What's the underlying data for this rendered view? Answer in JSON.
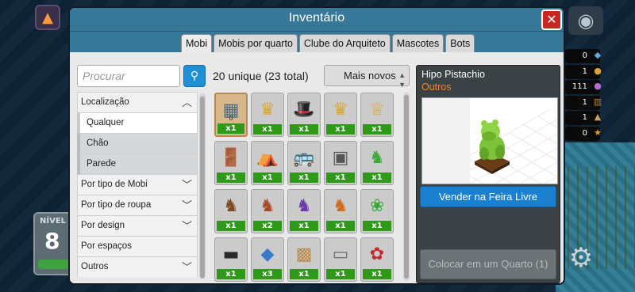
{
  "window": {
    "title": "Inventário",
    "close_label": "✕"
  },
  "tabs": [
    {
      "label": "Mobi",
      "active": true
    },
    {
      "label": "Mobis por quarto",
      "active": false
    },
    {
      "label": "Clube do Arquiteto",
      "active": false
    },
    {
      "label": "Mascotes",
      "active": false
    },
    {
      "label": "Bots",
      "active": false
    }
  ],
  "search": {
    "placeholder": "Procurar",
    "icon": "magnifier-icon"
  },
  "filters": {
    "location": {
      "label": "Localização",
      "expanded": true,
      "options": [
        "Qualquer",
        "Chão",
        "Parede"
      ],
      "selected": "Qualquer"
    },
    "groups": [
      {
        "label": "Por tipo de Mobi"
      },
      {
        "label": "Por tipo de roupa"
      },
      {
        "label": "Por design"
      },
      {
        "label": "Por espaços"
      },
      {
        "label": "Outros"
      }
    ]
  },
  "summary": {
    "count_text": "20 unique (23 total)"
  },
  "sort": {
    "selected": "Mais novos"
  },
  "items": [
    {
      "icon": "window-frame-icon",
      "glyph": "▦",
      "qty": "x1",
      "selected": true,
      "sub": "0"
    },
    {
      "icon": "gold-crown-icon",
      "glyph": "♛",
      "qty": "x1"
    },
    {
      "icon": "green-hat-icon",
      "glyph": "🎩",
      "qty": "x1"
    },
    {
      "icon": "gold-crown-icon",
      "glyph": "♛",
      "qty": "x1"
    },
    {
      "icon": "gold-cake-icon",
      "glyph": "♕",
      "qty": "x1"
    },
    {
      "icon": "door-icon",
      "glyph": "🚪",
      "qty": "x1"
    },
    {
      "icon": "table-icon",
      "glyph": "⛺",
      "qty": "x1"
    },
    {
      "icon": "van-icon",
      "glyph": "🚌",
      "qty": "x1"
    },
    {
      "icon": "safe-icon",
      "glyph": "▣",
      "qty": "x1"
    },
    {
      "icon": "green-hippo-statue-icon",
      "glyph": "♞",
      "qty": "x1"
    },
    {
      "icon": "brown-statue-icon",
      "glyph": "♞",
      "qty": "x1"
    },
    {
      "icon": "red-statue-icon",
      "glyph": "♞",
      "qty": "x2"
    },
    {
      "icon": "purple-statue-icon",
      "glyph": "♞",
      "qty": "x1"
    },
    {
      "icon": "orange-statue-icon",
      "glyph": "♞",
      "qty": "x1"
    },
    {
      "icon": "green-plant-icon",
      "glyph": "❀",
      "qty": "x1"
    },
    {
      "icon": "black-bench-icon",
      "glyph": "▬",
      "qty": "x1"
    },
    {
      "icon": "blue-mat-icon",
      "glyph": "◆",
      "qty": "x3"
    },
    {
      "icon": "wooden-crate-icon",
      "glyph": "▩",
      "qty": "x1"
    },
    {
      "icon": "gray-table-icon",
      "glyph": "▭",
      "qty": "x1"
    },
    {
      "icon": "rose-pot-icon",
      "glyph": "✿",
      "qty": "x1"
    }
  ],
  "preview": {
    "name": "Hipo Pistachio",
    "category": "Outros",
    "sell_label": "Vender na Feira Livre",
    "place_label": "Colocar em um Quarto (1)"
  },
  "hud": {
    "level_label": "NÍVEL",
    "level_value": "8",
    "currencies": [
      {
        "value": "0",
        "icon": "diamond-icon",
        "color": "#6aa7d8"
      },
      {
        "value": "1",
        "icon": "coin-icon",
        "color": "#d9a331"
      },
      {
        "value": "111",
        "icon": "ducket-icon",
        "color": "#b56fd2"
      },
      {
        "value": "1",
        "icon": "gate-icon",
        "color": "#c08a2b"
      },
      {
        "value": "1",
        "icon": "helmet-icon",
        "color": "#c9a05a"
      },
      {
        "value": "0",
        "icon": "star-icon",
        "color": "#e0a32c"
      }
    ]
  },
  "colors": {
    "titlebar": "#367897",
    "qty_badge": "#2f9a1a",
    "sell_button": "#1b80d0",
    "category_text": "#ee8a1c",
    "close_button": "#c8261f"
  }
}
